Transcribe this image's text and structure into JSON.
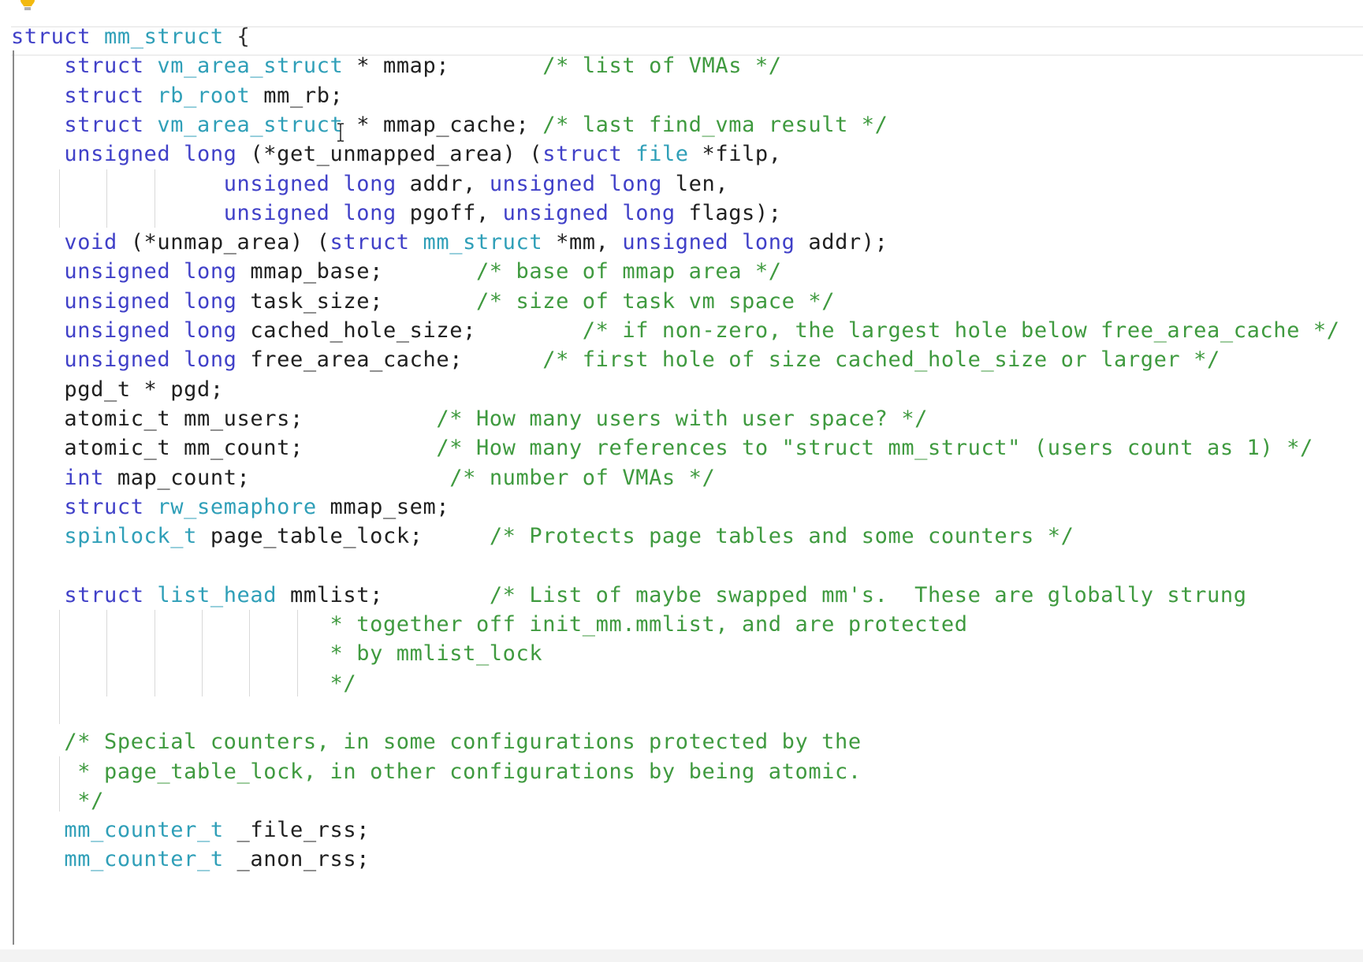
{
  "editor": {
    "lines": [
      {
        "indent": "",
        "tokens": [
          [
            "kw",
            "struct"
          ],
          [
            "id",
            " "
          ],
          [
            "ty",
            "mm_struct"
          ],
          [
            "pu",
            " {"
          ]
        ]
      },
      {
        "indent": "    ",
        "tokens": [
          [
            "kw",
            "struct"
          ],
          [
            "id",
            " "
          ],
          [
            "ty",
            "vm_area_struct"
          ],
          [
            "id",
            " * mmap;       "
          ],
          [
            "cm",
            "/* list of VMAs */"
          ]
        ]
      },
      {
        "indent": "    ",
        "tokens": [
          [
            "kw",
            "struct"
          ],
          [
            "id",
            " "
          ],
          [
            "ty",
            "rb_root"
          ],
          [
            "id",
            " mm_rb;"
          ]
        ]
      },
      {
        "indent": "    ",
        "tokens": [
          [
            "kw",
            "struct"
          ],
          [
            "id",
            " "
          ],
          [
            "ty",
            "vm_area_struct"
          ],
          [
            "id",
            " * mmap_cache; "
          ],
          [
            "cm",
            "/* last find_vma result */"
          ]
        ]
      },
      {
        "indent": "    ",
        "tokens": [
          [
            "kw",
            "unsigned long"
          ],
          [
            "id",
            " (*get_unmapped_area) ("
          ],
          [
            "kw",
            "struct"
          ],
          [
            "id",
            " "
          ],
          [
            "ty",
            "file"
          ],
          [
            "id",
            " *filp,"
          ]
        ]
      },
      {
        "indent": "                ",
        "tokens": [
          [
            "kw",
            "unsigned long"
          ],
          [
            "id",
            " addr, "
          ],
          [
            "kw",
            "unsigned long"
          ],
          [
            "id",
            " len,"
          ]
        ]
      },
      {
        "indent": "                ",
        "tokens": [
          [
            "kw",
            "unsigned long"
          ],
          [
            "id",
            " pgoff, "
          ],
          [
            "kw",
            "unsigned long"
          ],
          [
            "id",
            " flags);"
          ]
        ]
      },
      {
        "indent": "    ",
        "tokens": [
          [
            "kw",
            "void"
          ],
          [
            "id",
            " (*unmap_area) ("
          ],
          [
            "kw",
            "struct"
          ],
          [
            "id",
            " "
          ],
          [
            "ty",
            "mm_struct"
          ],
          [
            "id",
            " *mm, "
          ],
          [
            "kw",
            "unsigned long"
          ],
          [
            "id",
            " addr);"
          ]
        ]
      },
      {
        "indent": "    ",
        "tokens": [
          [
            "kw",
            "unsigned long"
          ],
          [
            "id",
            " mmap_base;       "
          ],
          [
            "cm",
            "/* base of mmap area */"
          ]
        ]
      },
      {
        "indent": "    ",
        "tokens": [
          [
            "kw",
            "unsigned long"
          ],
          [
            "id",
            " task_size;       "
          ],
          [
            "cm",
            "/* size of task vm space */"
          ]
        ]
      },
      {
        "indent": "    ",
        "tokens": [
          [
            "kw",
            "unsigned long"
          ],
          [
            "id",
            " cached_hole_size;        "
          ],
          [
            "cm",
            "/* if non-zero, the largest hole below free_area_cache */"
          ]
        ]
      },
      {
        "indent": "    ",
        "tokens": [
          [
            "kw",
            "unsigned long"
          ],
          [
            "id",
            " free_area_cache;      "
          ],
          [
            "cm",
            "/* first hole of size cached_hole_size or larger */"
          ]
        ]
      },
      {
        "indent": "    ",
        "tokens": [
          [
            "id",
            "pgd_t * pgd;"
          ]
        ]
      },
      {
        "indent": "    ",
        "tokens": [
          [
            "id",
            "atomic_t mm_users;          "
          ],
          [
            "cm",
            "/* How many users with user space? */"
          ]
        ]
      },
      {
        "indent": "    ",
        "tokens": [
          [
            "id",
            "atomic_t mm_count;          "
          ],
          [
            "cm",
            "/* How many references to \"struct mm_struct\" (users count as 1) */"
          ]
        ]
      },
      {
        "indent": "    ",
        "tokens": [
          [
            "kw",
            "int"
          ],
          [
            "id",
            " map_count;               "
          ],
          [
            "cm",
            "/* number of VMAs */"
          ]
        ]
      },
      {
        "indent": "    ",
        "tokens": [
          [
            "kw",
            "struct"
          ],
          [
            "id",
            " "
          ],
          [
            "ty",
            "rw_semaphore"
          ],
          [
            "id",
            " mmap_sem;"
          ]
        ]
      },
      {
        "indent": "    ",
        "tokens": [
          [
            "ty",
            "spinlock_t"
          ],
          [
            "id",
            " page_table_lock;     "
          ],
          [
            "cm",
            "/* Protects page tables and some counters */"
          ]
        ]
      },
      {
        "indent": "",
        "tokens": []
      },
      {
        "indent": "    ",
        "tokens": [
          [
            "kw",
            "struct"
          ],
          [
            "id",
            " "
          ],
          [
            "ty",
            "list_head"
          ],
          [
            "id",
            " mmlist;        "
          ],
          [
            "cm",
            "/* List of maybe swapped mm's.  These are globally strung"
          ]
        ]
      },
      {
        "indent": "                        ",
        "tokens": [
          [
            "cm",
            "* together off init_mm.mmlist, and are protected"
          ]
        ]
      },
      {
        "indent": "                        ",
        "tokens": [
          [
            "cm",
            "* by mmlist_lock"
          ]
        ]
      },
      {
        "indent": "                        ",
        "tokens": [
          [
            "cm",
            "*/"
          ]
        ]
      },
      {
        "indent": "",
        "tokens": []
      },
      {
        "indent": "    ",
        "tokens": [
          [
            "cm",
            "/* Special counters, in some configurations protected by the"
          ]
        ]
      },
      {
        "indent": "    ",
        "tokens": [
          [
            "cm",
            " * page_table_lock, in other configurations by being atomic."
          ]
        ]
      },
      {
        "indent": "    ",
        "tokens": [
          [
            "cm",
            " */"
          ]
        ]
      },
      {
        "indent": "    ",
        "tokens": [
          [
            "ty",
            "mm_counter_t"
          ],
          [
            "id",
            " _file_rss;"
          ]
        ]
      },
      {
        "indent": "    ",
        "tokens": [
          [
            "ty",
            "mm_counter_t"
          ],
          [
            "id",
            " _anon_rss;"
          ]
        ]
      }
    ]
  },
  "icons": {
    "lightbulb": "lightbulb-icon",
    "cursor": "text-cursor-icon"
  },
  "colors": {
    "keyword": "#4040c8",
    "type": "#2f9fb8",
    "comment": "#3f9a3f",
    "text": "#202020"
  }
}
